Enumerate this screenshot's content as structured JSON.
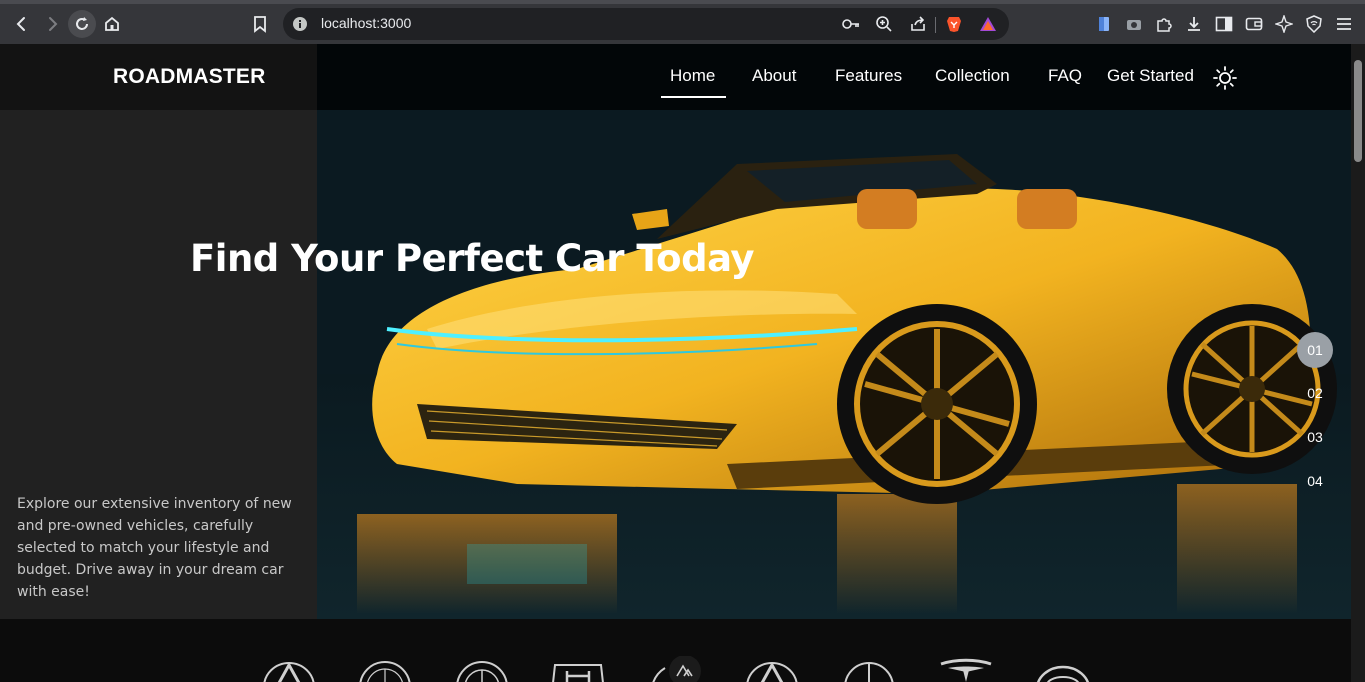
{
  "browser": {
    "url": "localhost:3000",
    "icons": {
      "back": "back-arrow-icon",
      "forward": "forward-arrow-icon",
      "reload": "reload-icon",
      "home": "home-icon",
      "bookmark": "bookmark-icon",
      "site_info": "info-icon",
      "password": "key-icon",
      "zoom": "zoom-icon",
      "share": "share-icon",
      "brave_shield": "brave-lion-icon",
      "brave_rewards": "rewards-triangle-icon"
    }
  },
  "site": {
    "brand": "ROADMASTER",
    "nav": {
      "home": "Home",
      "about": "About",
      "features": "Features",
      "collection": "Collection",
      "faq": "FAQ",
      "get_started": "Get Started"
    },
    "hero": {
      "headline": "Find Your Perfect Car Today",
      "description": "Explore our extensive inventory of new and pre-owned vehicles, carefully selected to match your lifestyle and budget. Drive away in your dream car with ease!",
      "slides": [
        "01",
        "02",
        "03",
        "04"
      ],
      "active_slide": 0
    },
    "brand_logos": [
      "acura-logo",
      "alfa-romeo-logo",
      "bmw-logo",
      "honda-logo",
      "nuxt-badge",
      "acura-logo",
      "mercedes-logo",
      "tesla-logo",
      "toyota-logo"
    ]
  },
  "colors": {
    "accent_car": "#f2b320",
    "chrome_bg": "#35363a",
    "page_bg": "#0c0c0c"
  }
}
